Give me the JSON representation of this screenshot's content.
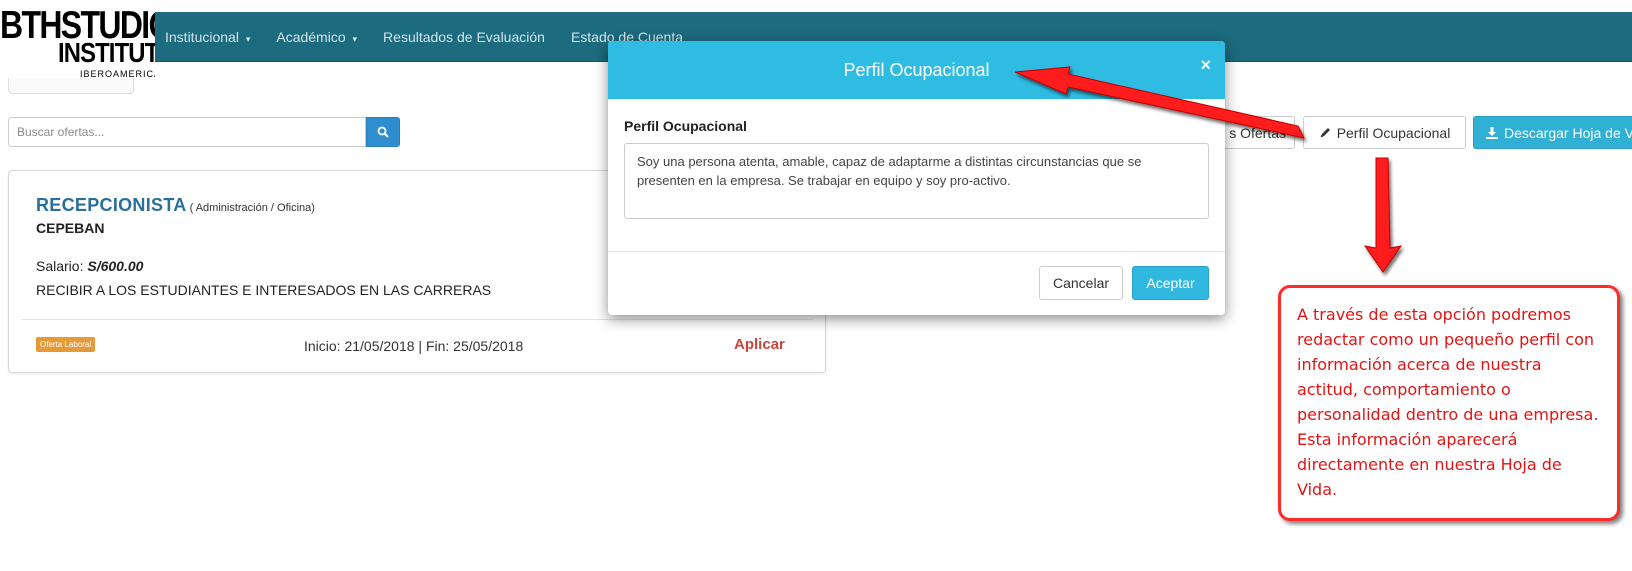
{
  "logo": {
    "line1": "BTHSTUDIO",
    "line2": "INSTITUTE",
    "line3": "IBEROAMERICANA"
  },
  "nav": {
    "items": [
      {
        "label": "Institucional",
        "caret": "▾"
      },
      {
        "label": "Académico",
        "caret": "▾"
      },
      {
        "label": "Resultados de Evaluación",
        "caret": ""
      },
      {
        "label": "Estado de Cuenta",
        "caret": ""
      }
    ]
  },
  "search": {
    "placeholder": "Buscar ofertas...",
    "icon": "search-icon"
  },
  "job": {
    "title": "RECEPCIONISTA",
    "category": "( Administración / Oficina)",
    "company": "CEPEBAN",
    "salary_label": "Salario:",
    "salary_value": "S/600.00",
    "description": "RECIBIR A LOS ESTUDIANTES E INTERESADOS EN LAS CARRERAS",
    "badge": "Oferta Laboral",
    "dates": "Inicio: 21/05/2018 | Fin: 25/05/2018",
    "apply_label": "Aplicar",
    "badge_color": "#e59a3a",
    "apply_color": "#c9463d"
  },
  "toolbar": {
    "ofertas_label": "s Ofertas",
    "perfil_label": "Perfil Ocupacional",
    "perfil_icon": "pencil-icon",
    "descargar_label": "Descargar Hoja de V",
    "descargar_icon": "download-icon"
  },
  "modal": {
    "title": "Perfil Ocupacional",
    "close": "×",
    "field_label": "Perfil Ocupacional",
    "field_value": "Soy una persona atenta, amable, capaz de adaptarme a distintas circunstancias que se presenten en la empresa. Se trabajar en equipo y soy pro-activo.",
    "cancel_label": "Cancelar",
    "ok_label": "Aceptar",
    "header_color": "#2fbce3"
  },
  "annotation": {
    "text": "A través de esta opción podremos redactar como un pequeño perfil con información acerca de nuestra actitud, comportamiento o personalidad dentro de una empresa. Esta información aparecerá directamente en nuestra Hoja de Vida.",
    "color": "#ff2a2a"
  },
  "colors": {
    "topbar": "#1c6b7e",
    "primary": "#2f8ecf",
    "info": "#31b0d5"
  }
}
